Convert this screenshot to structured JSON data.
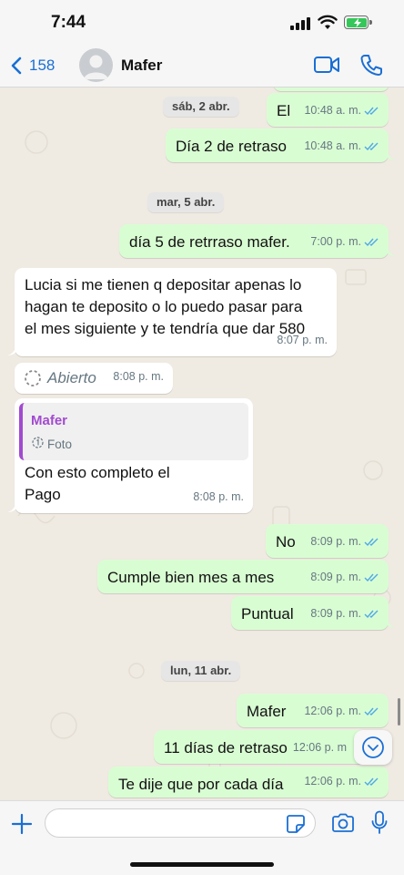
{
  "status": {
    "time": "7:44"
  },
  "header": {
    "back_count": "158",
    "contact_name": "Mafer"
  },
  "colors": {
    "accent": "#1a6fd4",
    "outgoing_bubble": "#d9fdd3",
    "incoming_bubble": "#ffffff",
    "chat_background": "#efeae2",
    "quote_accent": "#a24ad0",
    "read_ticks": "#4fa8e8",
    "battery": "#35c759"
  },
  "chat": {
    "dates": {
      "d1": "sáb, 2 abr.",
      "d2": "mar, 5 abr.",
      "d3": "lun, 11 abr."
    },
    "messages": {
      "m1": {
        "text": "El",
        "time": "10:48 a. m."
      },
      "m2": {
        "text": "Día 2 de retraso",
        "time": "10:48 a. m."
      },
      "m3": {
        "text": "día 5 de retrraso mafer.",
        "time": "7:00 p. m."
      },
      "m4": {
        "line1": "Lucia si me tienen q depositar apenas lo",
        "line2": "hagan te deposito o lo puedo pasar para",
        "line3": "el mes siguiente y te tendría que dar 580",
        "time": "8:07 p. m."
      },
      "m5": {
        "text": "Abierto",
        "time": "8:08 p. m."
      },
      "m6": {
        "quote_author": "Mafer",
        "quote_type": "Foto",
        "line1": "Con esto completo el",
        "line2": "Pago",
        "time": "8:08 p. m."
      },
      "m7": {
        "text": "No",
        "time": "8:09 p. m."
      },
      "m8": {
        "text": "Cumple bien mes a mes",
        "time": "8:09 p. m."
      },
      "m9": {
        "text": "Puntual",
        "time": "8:09 p. m."
      },
      "m10": {
        "text": "Mafer",
        "time": "12:06 p. m."
      },
      "m11": {
        "text": "11 días de retraso",
        "time": "12:06 p. m"
      },
      "m12": {
        "text": "Te dije que por cada día",
        "time": "12:06 p. m."
      }
    }
  },
  "input": {
    "value": "",
    "placeholder": ""
  }
}
